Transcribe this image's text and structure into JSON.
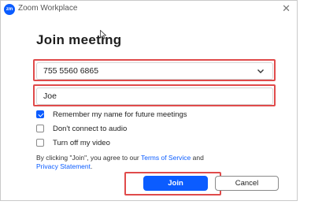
{
  "window": {
    "title": "Zoom Workplace",
    "logo_text": "zm",
    "close_glyph": "✕"
  },
  "heading": "Join meeting",
  "meeting_id": {
    "value": "755 5560 6865"
  },
  "name_field": {
    "value": "Joe"
  },
  "options": [
    {
      "label": "Remember my name for future meetings",
      "checked": true
    },
    {
      "label": "Don't connect to audio",
      "checked": false
    },
    {
      "label": "Turn off my video",
      "checked": false
    }
  ],
  "terms": {
    "prefix": "By clicking \"Join\", you agree to our ",
    "tos_link": "Terms of Service",
    "middle": " and",
    "privacy_link": "Privacy Statement",
    "suffix": "."
  },
  "buttons": {
    "join": "Join",
    "cancel": "Cancel"
  },
  "colors": {
    "accent": "#0b5cff",
    "highlight": "#e04b4b"
  },
  "icons": {
    "logo": "zoom-logo-icon",
    "close": "close-icon",
    "dropdown": "chevron-down-icon",
    "pointer": "mouse-cursor-icon"
  }
}
